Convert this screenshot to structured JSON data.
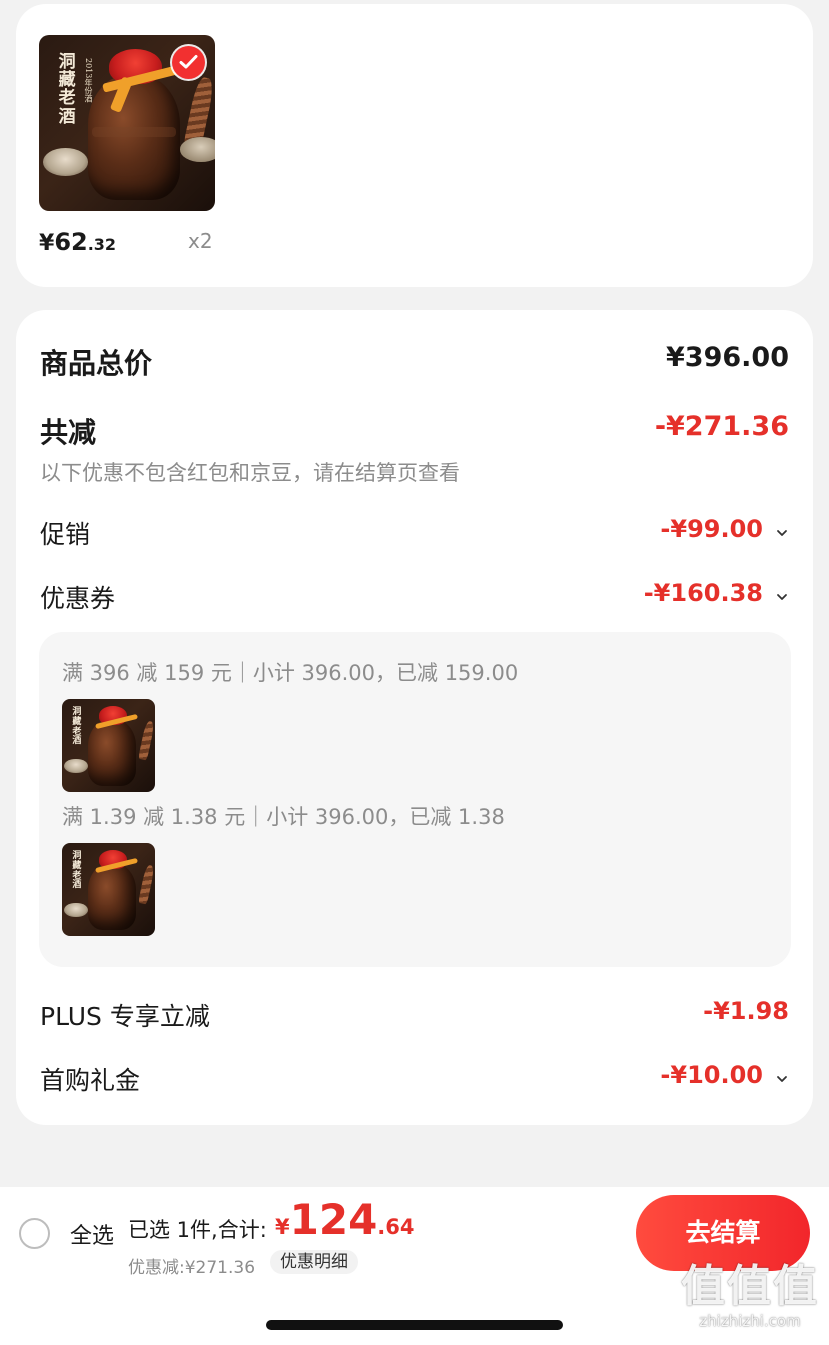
{
  "product": {
    "image_label": "洞\n藏\n老\n酒",
    "image_sub": "2013年份酒",
    "price_symbol": "¥",
    "price_int": "62",
    "price_dec": ".32",
    "quantity": "x2",
    "selected": true
  },
  "summary": {
    "goods_total_label": "商品总价",
    "goods_total_value": "¥396.00",
    "total_discount_label": "共减",
    "total_discount_value": "-¥271.36",
    "note": "以下优惠不包含红包和京豆，请在结算页查看",
    "promo_label": "促销",
    "promo_value": "-¥99.00",
    "coupon_label": "优惠券",
    "coupon_value": "-¥160.38",
    "coupons": [
      {
        "text": "满 396 减 159 元｜小计 396.00，已减 159.00"
      },
      {
        "text": "满 1.39 减 1.38 元｜小计 396.00，已减 1.38"
      }
    ],
    "plus_label": "PLUS 专享立减",
    "plus_value": "-¥1.98",
    "first_buy_label": "首购礼金",
    "first_buy_value": "-¥10.00"
  },
  "bottom_bar": {
    "select_all_label": "全选",
    "selected_text": "已选 1件,合计:",
    "total_symbol": "¥",
    "total_int": "124",
    "total_dec": ".64",
    "discount_text": "优惠减:¥271.36",
    "discount_detail_label": "优惠明细",
    "checkout_label": "去结算"
  },
  "watermark": {
    "logo": "值值值",
    "url": "zhizhizhi.com"
  },
  "colors": {
    "accent_red": "#e5302a",
    "checkout_gradient_start": "#ff4b3e",
    "checkout_gradient_end": "#f2262b",
    "background": "#f2f2f2"
  },
  "icons": [
    "check-circle-icon",
    "chevron-down-icon",
    "radio-circle-icon"
  ]
}
